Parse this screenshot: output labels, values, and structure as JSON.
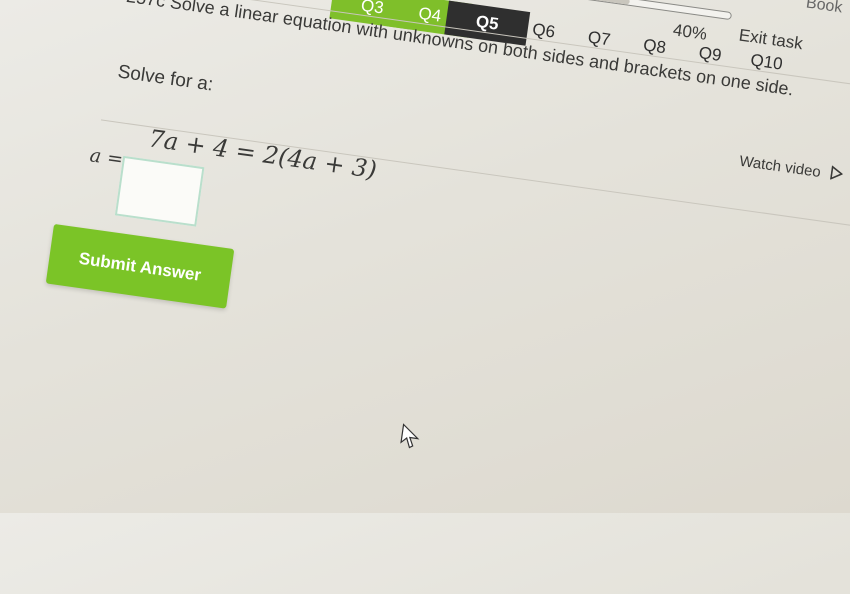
{
  "header": {
    "book_label": "Book",
    "tabs": [
      {
        "label": "Q3"
      },
      {
        "label": "Q4"
      },
      {
        "label": "Q5"
      },
      {
        "label": "Q6"
      },
      {
        "label": "Q7"
      },
      {
        "label": "Q8"
      },
      {
        "label": "Q9"
      },
      {
        "label": "Q10"
      }
    ],
    "progress_text": "40%",
    "progress_value": 0.4,
    "exit_label": "Exit task"
  },
  "task": {
    "title": "257c Solve a linear equation with unknowns on both sides and brackets on one side.",
    "watch_video_label": "Watch video"
  },
  "question": {
    "prompt": "Solve for a:",
    "equation": "7a + 4 = 2(4a + 3)",
    "answer_label": "a =",
    "answer_value": ""
  },
  "actions": {
    "submit_label": "Submit Answer"
  },
  "colors": {
    "accent_green": "#7bc427",
    "current_tab": "#2f2f2f",
    "completed_tab": "#7fbf2a"
  }
}
